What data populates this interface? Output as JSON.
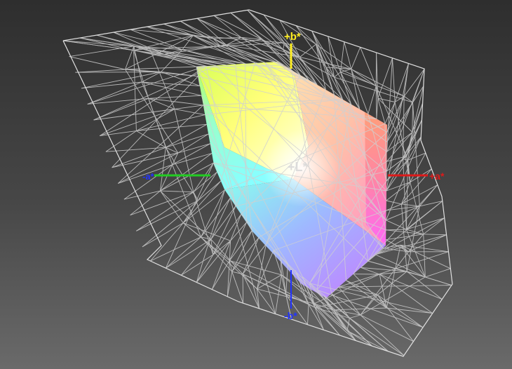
{
  "axes": {
    "plus_b": "+b*",
    "minus_b": "-b*",
    "plus_a": "+a*",
    "minus_a": "-a*",
    "plus_L": "+L*"
  },
  "colors": {
    "plus_b": "#ffee22",
    "minus_b": "#2233ff",
    "plus_a": "#dd1a1a",
    "minus_a_line": "#22cc22",
    "minus_a_label": "#2233ff",
    "plus_L": "#d8d8d8",
    "wireframe": "#d0d0d0"
  }
}
